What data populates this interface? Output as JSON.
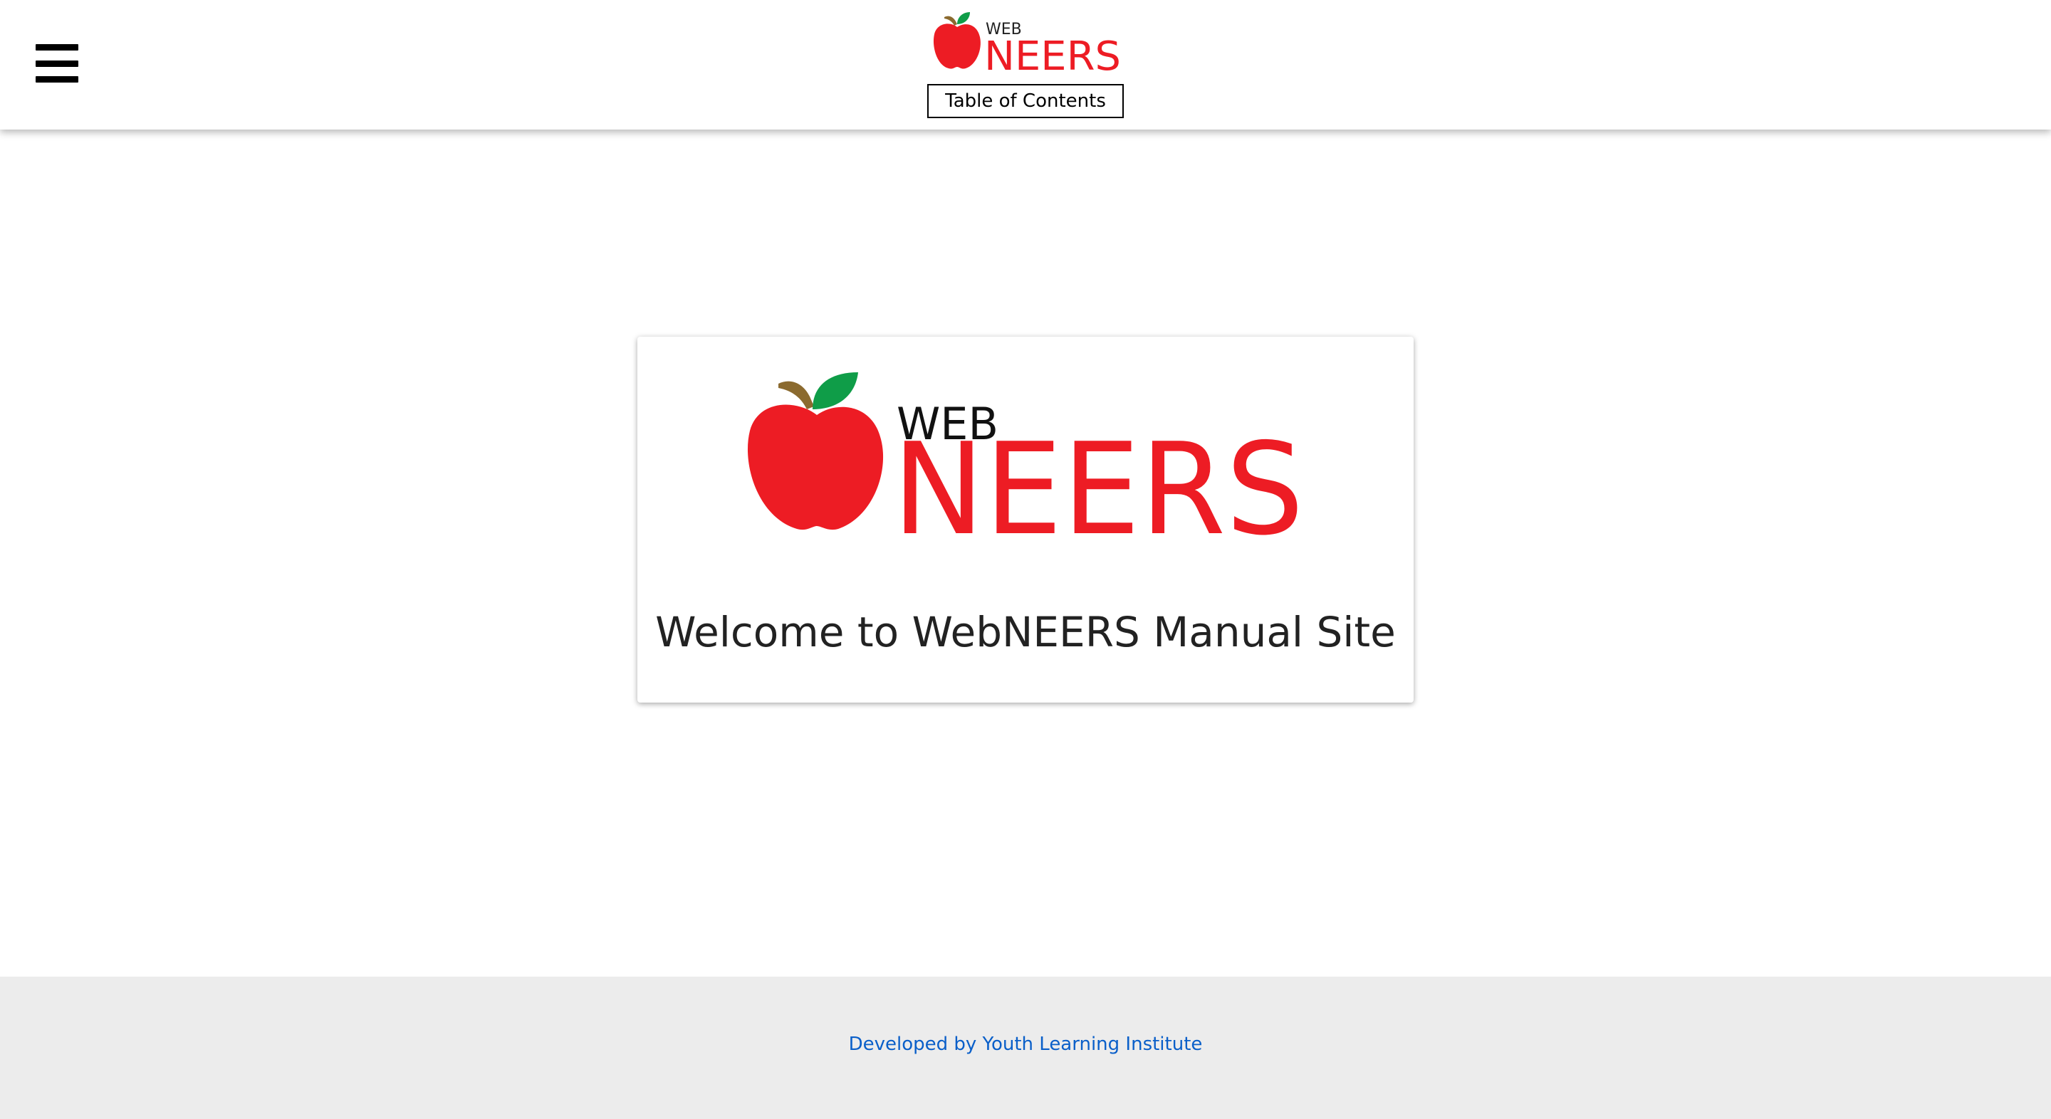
{
  "header": {
    "logo": {
      "small_text": "WEB",
      "large_text": "NEERS",
      "alt": "WebNEERS"
    },
    "toc_label": "Table of Contents",
    "menu_icon": "hamburger-menu-icon"
  },
  "main": {
    "logo": {
      "small_text": "WEB",
      "large_text": "NEERS"
    },
    "welcome_text": "Welcome to WebNEERS Manual Site"
  },
  "footer": {
    "credit_text": "Developed by Youth Learning Institute"
  },
  "colors": {
    "brand_red": "#ed1c24",
    "leaf_green": "#0f9d48",
    "stem_brown": "#8b6a2f",
    "link_blue": "#0a5fc9",
    "footer_bg": "#ececec"
  }
}
